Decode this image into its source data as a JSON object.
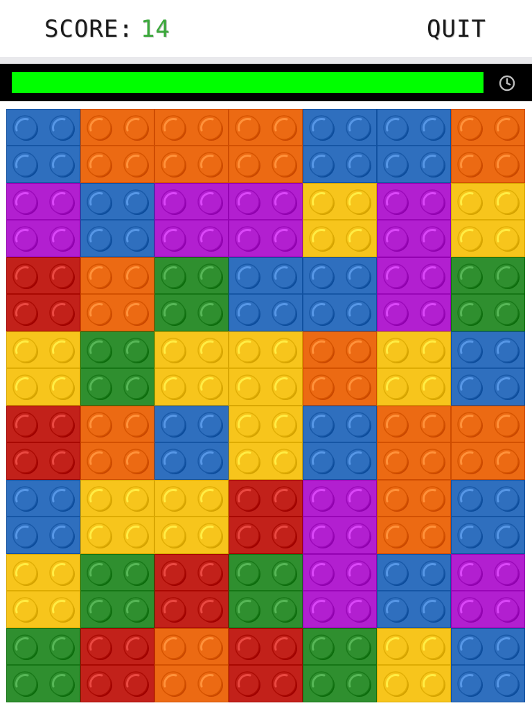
{
  "header": {
    "score_label": "SCORE:",
    "score_value": "14",
    "quit_label": "QUIT"
  },
  "timer": {
    "remaining_fraction": 1.0,
    "fill_color": "#00ff00",
    "icon": "clock-icon"
  },
  "colors": {
    "blue": "#2f6fbe",
    "orange": "#ec6a13",
    "purple": "#b21fd0",
    "yellow": "#f7c51c",
    "red": "#c2211a",
    "green": "#2f8f2f"
  },
  "board": {
    "rows": 8,
    "cols": 7,
    "grid": [
      [
        "blue",
        "orange",
        "orange",
        "orange",
        "blue",
        "blue",
        "orange"
      ],
      [
        "purple",
        "blue",
        "purple",
        "purple",
        "yellow",
        "purple",
        "yellow"
      ],
      [
        "red",
        "orange",
        "green",
        "blue",
        "blue",
        "purple",
        "green"
      ],
      [
        "yellow",
        "green",
        "yellow",
        "yellow",
        "orange",
        "yellow",
        "blue"
      ],
      [
        "red",
        "orange",
        "blue",
        "yellow",
        "blue",
        "orange",
        "orange"
      ],
      [
        "blue",
        "yellow",
        "yellow",
        "red",
        "purple",
        "orange",
        "blue"
      ],
      [
        "yellow",
        "green",
        "red",
        "green",
        "purple",
        "blue",
        "purple"
      ],
      [
        "green",
        "red",
        "orange",
        "red",
        "green",
        "yellow",
        "blue"
      ]
    ]
  }
}
